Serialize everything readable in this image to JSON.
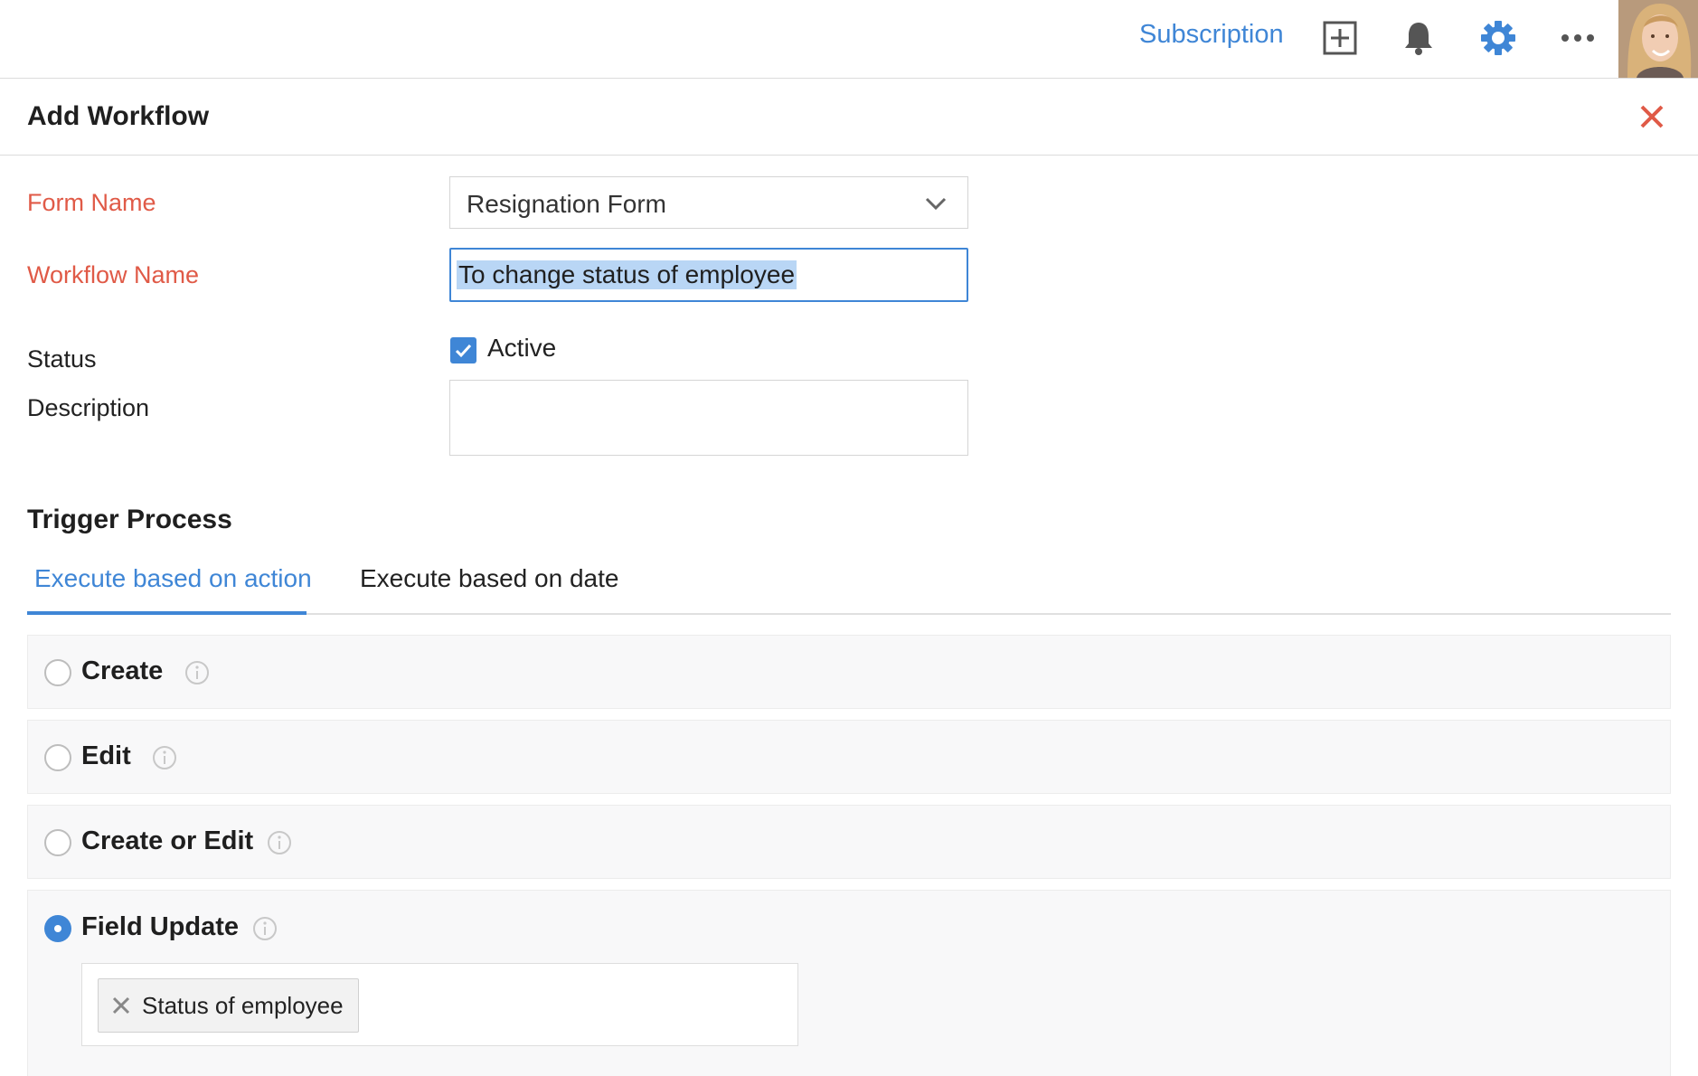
{
  "topbar": {
    "subscription_label": "Subscription",
    "icons": [
      "add-square-icon",
      "bell-icon",
      "gear-icon",
      "more-horizontal-icon"
    ],
    "accent_color": "#3f86d6"
  },
  "header": {
    "title": "Add Workflow",
    "close_icon": "close-icon",
    "close_color": "#e05a47"
  },
  "form": {
    "form_name_label": "Form Name",
    "form_name_value": "Resignation Form",
    "workflow_name_label": "Workflow Name",
    "workflow_name_value": "To change status of employee",
    "status_label": "Status",
    "status_checkbox_label": "Active",
    "status_checked": true,
    "description_label": "Description",
    "description_value": ""
  },
  "trigger": {
    "section_title": "Trigger Process",
    "tabs": [
      {
        "label": "Execute based on action",
        "active": true
      },
      {
        "label": "Execute based on date",
        "active": false
      }
    ],
    "options": [
      {
        "label": "Create",
        "selected": false
      },
      {
        "label": "Edit",
        "selected": false
      },
      {
        "label": "Create or Edit",
        "selected": false
      },
      {
        "label": "Field Update",
        "selected": true
      }
    ],
    "selected_fields": [
      "Status of employee"
    ]
  }
}
